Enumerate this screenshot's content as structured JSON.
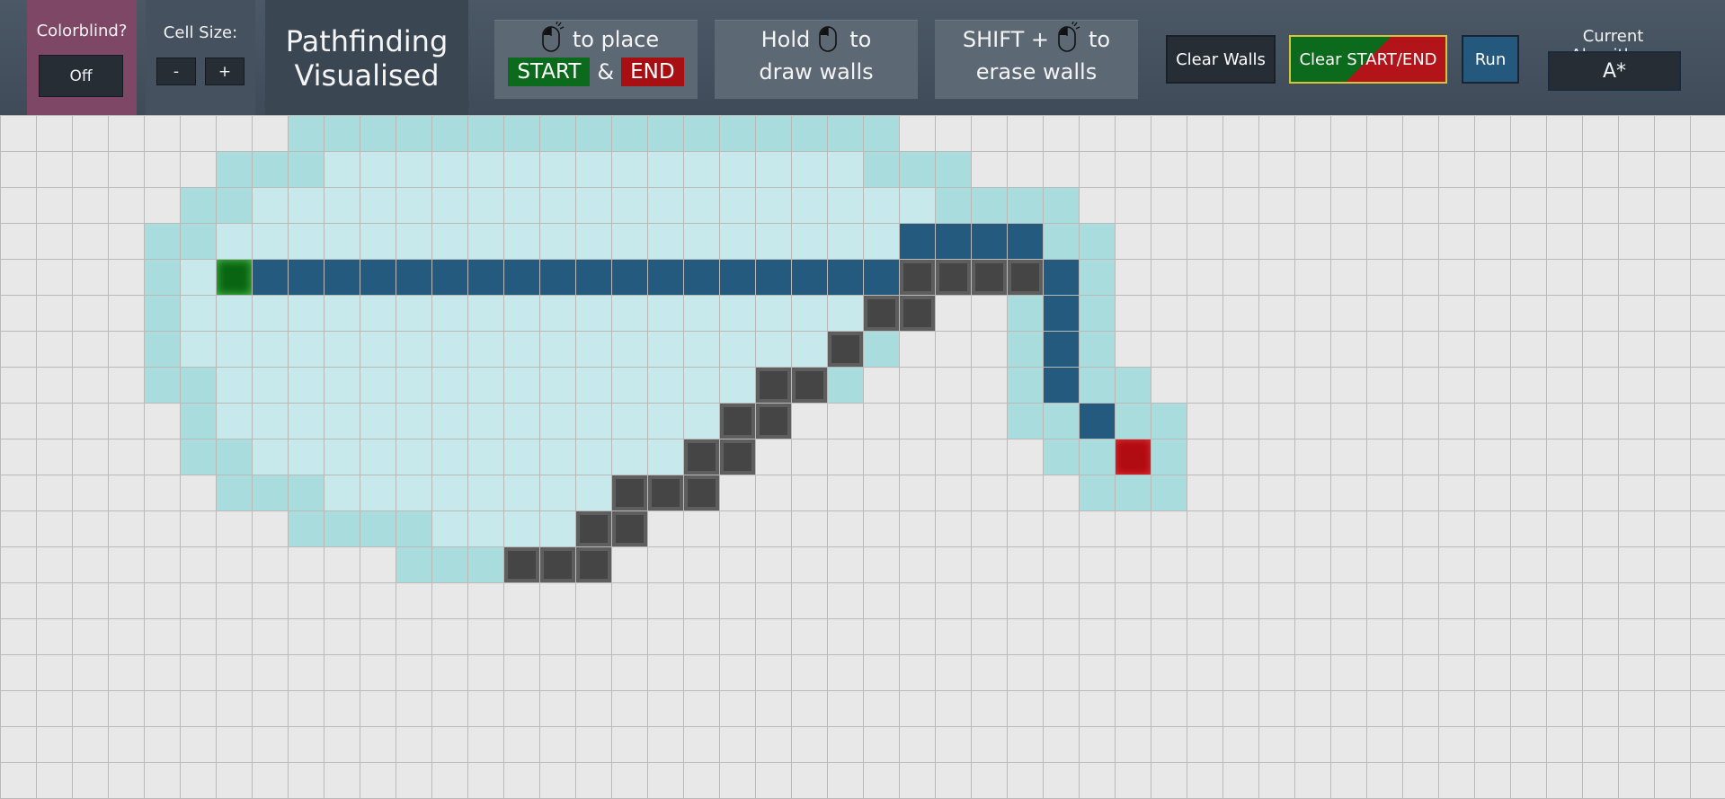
{
  "header": {
    "colorblind_label": "Colorblind?",
    "colorblind_value": "Off",
    "cell_size_label": "Cell Size:",
    "cell_size_minus": "-",
    "cell_size_plus": "+",
    "title_line1": "Pathfinding",
    "title_line2": "Visualised",
    "instructions": {
      "place": {
        "text": "to place",
        "start": "START",
        "amp": "&",
        "end": "END"
      },
      "draw": {
        "before": "Hold",
        "after": "to",
        "line2": "draw walls"
      },
      "erase": {
        "before": "SHIFT +",
        "after": "to",
        "line2": "erase walls"
      }
    },
    "clear_walls": "Clear Walls",
    "clear_start_end": "Clear START/END",
    "run": "Run",
    "algorithm_label": "Current Algorithm:",
    "algorithm_value": "A*"
  },
  "colors": {
    "visited": "#a9dcdd",
    "frontier": "#c8e9eb",
    "path": "#245a7e",
    "wall": "#454545",
    "start": "#0a6512",
    "end": "#b10c12",
    "colorblind_panel": "#7e4766"
  },
  "grid": {
    "start": [
      6,
      4
    ],
    "end": [
      31,
      9
    ],
    "walls": [
      [
        25,
        4
      ],
      [
        26,
        4
      ],
      [
        27,
        4
      ],
      [
        28,
        4
      ],
      [
        24,
        5
      ],
      [
        25,
        5
      ],
      [
        23,
        6
      ],
      [
        21,
        7
      ],
      [
        22,
        7
      ],
      [
        20,
        8
      ],
      [
        21,
        8
      ],
      [
        19,
        9
      ],
      [
        20,
        9
      ],
      [
        17,
        10
      ],
      [
        18,
        10
      ],
      [
        19,
        10
      ],
      [
        16,
        11
      ],
      [
        17,
        11
      ],
      [
        14,
        12
      ],
      [
        15,
        12
      ],
      [
        16,
        12
      ]
    ],
    "path": [
      [
        7,
        4
      ],
      [
        8,
        4
      ],
      [
        9,
        4
      ],
      [
        10,
        4
      ],
      [
        11,
        4
      ],
      [
        12,
        4
      ],
      [
        13,
        4
      ],
      [
        14,
        4
      ],
      [
        15,
        4
      ],
      [
        16,
        4
      ],
      [
        17,
        4
      ],
      [
        18,
        4
      ],
      [
        19,
        4
      ],
      [
        20,
        4
      ],
      [
        21,
        4
      ],
      [
        22,
        4
      ],
      [
        23,
        4
      ],
      [
        24,
        4
      ],
      [
        25,
        3
      ],
      [
        26,
        3
      ],
      [
        27,
        3
      ],
      [
        28,
        3
      ],
      [
        29,
        4
      ],
      [
        29,
        5
      ],
      [
        29,
        6
      ],
      [
        29,
        7
      ],
      [
        30,
        8
      ]
    ],
    "visited": [
      [
        8,
        0
      ],
      [
        9,
        0
      ],
      [
        10,
        0
      ],
      [
        11,
        0
      ],
      [
        12,
        0
      ],
      [
        13,
        0
      ],
      [
        14,
        0
      ],
      [
        15,
        0
      ],
      [
        16,
        0
      ],
      [
        17,
        0
      ],
      [
        18,
        0
      ],
      [
        19,
        0
      ],
      [
        20,
        0
      ],
      [
        21,
        0
      ],
      [
        22,
        0
      ],
      [
        23,
        0
      ],
      [
        24,
        0
      ],
      [
        6,
        1
      ],
      [
        7,
        1
      ],
      [
        8,
        1
      ],
      [
        24,
        1
      ],
      [
        25,
        1
      ],
      [
        26,
        1
      ],
      [
        5,
        2
      ],
      [
        6,
        2
      ],
      [
        26,
        2
      ],
      [
        27,
        2
      ],
      [
        28,
        2
      ],
      [
        29,
        2
      ],
      [
        4,
        3
      ],
      [
        5,
        3
      ],
      [
        29,
        3
      ],
      [
        30,
        3
      ],
      [
        4,
        4
      ],
      [
        30,
        4
      ],
      [
        4,
        5
      ],
      [
        28,
        5
      ],
      [
        30,
        5
      ],
      [
        4,
        6
      ],
      [
        24,
        6
      ],
      [
        28,
        6
      ],
      [
        30,
        6
      ],
      [
        4,
        7
      ],
      [
        5,
        7
      ],
      [
        23,
        7
      ],
      [
        28,
        7
      ],
      [
        30,
        7
      ],
      [
        31,
        7
      ],
      [
        5,
        8
      ],
      [
        28,
        8
      ],
      [
        29,
        8
      ],
      [
        31,
        8
      ],
      [
        32,
        8
      ],
      [
        5,
        9
      ],
      [
        6,
        9
      ],
      [
        29,
        9
      ],
      [
        30,
        9
      ],
      [
        32,
        9
      ],
      [
        6,
        10
      ],
      [
        7,
        10
      ],
      [
        8,
        10
      ],
      [
        30,
        10
      ],
      [
        31,
        10
      ],
      [
        32,
        10
      ],
      [
        8,
        11
      ],
      [
        9,
        11
      ],
      [
        10,
        11
      ],
      [
        11,
        11
      ],
      [
        11,
        12
      ],
      [
        12,
        12
      ],
      [
        13,
        12
      ]
    ],
    "frontier_rows": [
      [
        1,
        9,
        23
      ],
      [
        2,
        7,
        25
      ],
      [
        3,
        6,
        24
      ],
      [
        4,
        5,
        5
      ],
      [
        5,
        5,
        23
      ],
      [
        6,
        5,
        22
      ],
      [
        7,
        6,
        20
      ],
      [
        8,
        6,
        19
      ],
      [
        9,
        7,
        18
      ],
      [
        10,
        9,
        16
      ],
      [
        11,
        12,
        15
      ]
    ]
  }
}
